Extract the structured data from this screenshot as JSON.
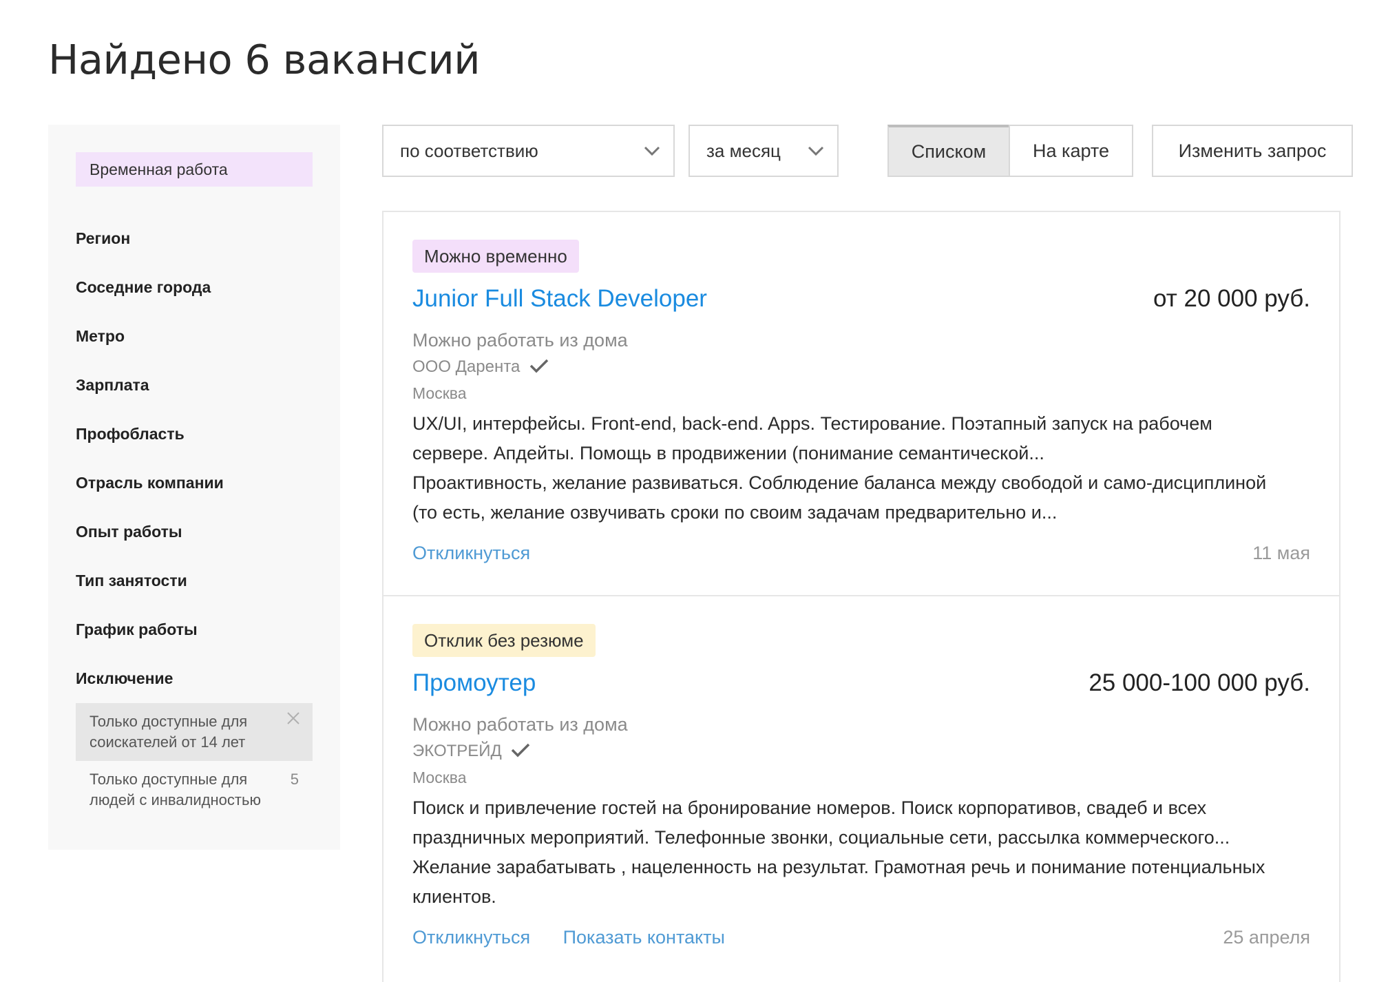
{
  "page": {
    "title": "Найдено 6 вакансий"
  },
  "sidebar": {
    "temp_chip": "Временная работа",
    "filters": [
      "Регион",
      "Соседние города",
      "Метро",
      "Зарплата",
      "Профобласть",
      "Отрасль компании",
      "Опыт работы",
      "Тип занятости",
      "График работы"
    ],
    "exclusion": {
      "title": "Исключение",
      "options": [
        {
          "label": "Только доступные для соискателей от 14 лет",
          "selected": true
        },
        {
          "label": "Только доступные для людей с инвалидностью",
          "count": "5"
        }
      ]
    }
  },
  "toolbar": {
    "sort": {
      "value": "по соответствию"
    },
    "period": {
      "value": "за месяц"
    },
    "view_list": "Списком",
    "view_map": "На карте",
    "change_query": "Изменить запрос"
  },
  "vacancies": [
    {
      "badge": "Можно временно",
      "title": "Junior Full Stack Developer",
      "salary": "от 20 000 руб.",
      "remote": "Можно работать из дома",
      "company": "ООО Дарента",
      "city": "Москва",
      "desc1": "UX/UI, интерфейсы. Front-end, back-end. Apps. Тестирование. Поэтапный запуск на рабочем сервере. Апдейты. Помощь в продвижении (понимание семантической...",
      "desc2": "Проактивность, желание развиваться. Соблюдение баланса между свободой и само-дисциплиной (то есть, желание озвучивать сроки по своим задачам предварительно и...",
      "respond": "Откликнуться",
      "date": "11 мая"
    },
    {
      "badge": "Отклик без резюме",
      "title": "Промоутер",
      "salary": "25 000-100 000 руб.",
      "remote": "Можно работать из дома",
      "company": "ЭКОТРЕЙД",
      "city": "Москва",
      "desc1": "Поиск и привлечение гостей на бронирование номеров. Поиск корпоративов, свадеб и всех праздничных мероприятий. Телефонные звонки, социальные сети, рассылка коммерческого...",
      "desc2": "Желание зарабатывать , нацеленность на результат. Грамотная речь и понимание потенциальных клиентов.",
      "respond": "Откликнуться",
      "show_contacts": "Показать контакты",
      "date": "25 апреля"
    }
  ],
  "colors": {
    "link": "#1a8be0",
    "action_link": "#4f9ad4",
    "badge_temp": "#f4dffa",
    "badge_noresume": "#fdf2cf"
  },
  "icons": {
    "chevron": "chevron-down-icon",
    "verified": "check-icon",
    "remove": "close-icon"
  }
}
